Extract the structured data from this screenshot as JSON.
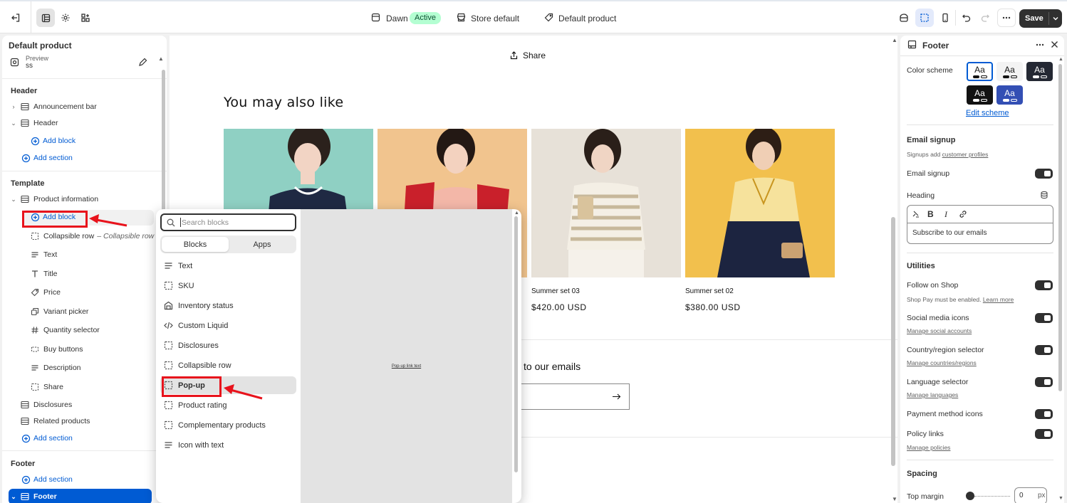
{
  "topbar": {
    "theme_name": "Dawn",
    "theme_status": "Active",
    "store": "Store default",
    "template": "Default product",
    "save_label": "Save"
  },
  "sidebar": {
    "title": "Default product",
    "preview_label": "Preview",
    "preview_value": "ss",
    "header_section": "Header",
    "header_items": [
      "Announcement bar",
      "Header"
    ],
    "add_block": "Add block",
    "add_section": "Add section",
    "template_section": "Template",
    "product_information": "Product information",
    "product_blocks": [
      {
        "label": "Collapsible row",
        "suffix": "Collapsible row"
      },
      {
        "label": "Text"
      },
      {
        "label": "Title"
      },
      {
        "label": "Price"
      },
      {
        "label": "Variant picker"
      },
      {
        "label": "Quantity selector"
      },
      {
        "label": "Buy buttons"
      },
      {
        "label": "Description"
      },
      {
        "label": "Share"
      }
    ],
    "template_sections": [
      "Disclosures",
      "Related products"
    ],
    "footer_section": "Footer",
    "footer_item": "Footer"
  },
  "preview": {
    "share": "Share",
    "heading": "You may also like",
    "products": [
      {
        "name": "Summer set 03",
        "price": "$420.00 USD"
      },
      {
        "name": "Summer set 02",
        "price": "$380.00 USD"
      }
    ],
    "subscribe_fragment": "to our emails"
  },
  "popup": {
    "search_placeholder": "Search blocks",
    "tabs": [
      "Blocks",
      "Apps"
    ],
    "items": [
      "Text",
      "SKU",
      "Inventory status",
      "Custom Liquid",
      "Disclosures",
      "Collapsible row",
      "Pop-up",
      "Product rating",
      "Complementary products",
      "Icon with text"
    ],
    "preview_text": "Pop-up link text"
  },
  "right_panel": {
    "title": "Footer",
    "color_scheme_label": "Color scheme",
    "swatch_text": "Aa",
    "edit_scheme": "Edit scheme",
    "email_signup_heading": "Email signup",
    "signups_text": "Signups add",
    "customer_profiles": "customer profiles",
    "email_signup_toggle": "Email signup",
    "heading_label": "Heading",
    "heading_value": "Subscribe to our emails",
    "utilities": "Utilities",
    "follow_on_shop": "Follow on Shop",
    "shop_pay_note": "Shop Pay must be enabled.",
    "learn_more": "Learn more",
    "social_media_icons": "Social media icons",
    "manage_social": "Manage social accounts",
    "country_selector": "Country/region selector",
    "manage_countries": "Manage countries/regions",
    "language_selector": "Language selector",
    "manage_languages": "Manage languages",
    "payment_icons": "Payment method icons",
    "policy_links": "Policy links",
    "manage_policies": "Manage policies",
    "spacing": "Spacing",
    "top_margin": "Top margin",
    "top_margin_value": "0",
    "top_margin_unit": "px",
    "swatch_colors": [
      "#ffffff",
      "#f3f3f3",
      "#242833",
      "#121212",
      "#334fb4"
    ]
  }
}
